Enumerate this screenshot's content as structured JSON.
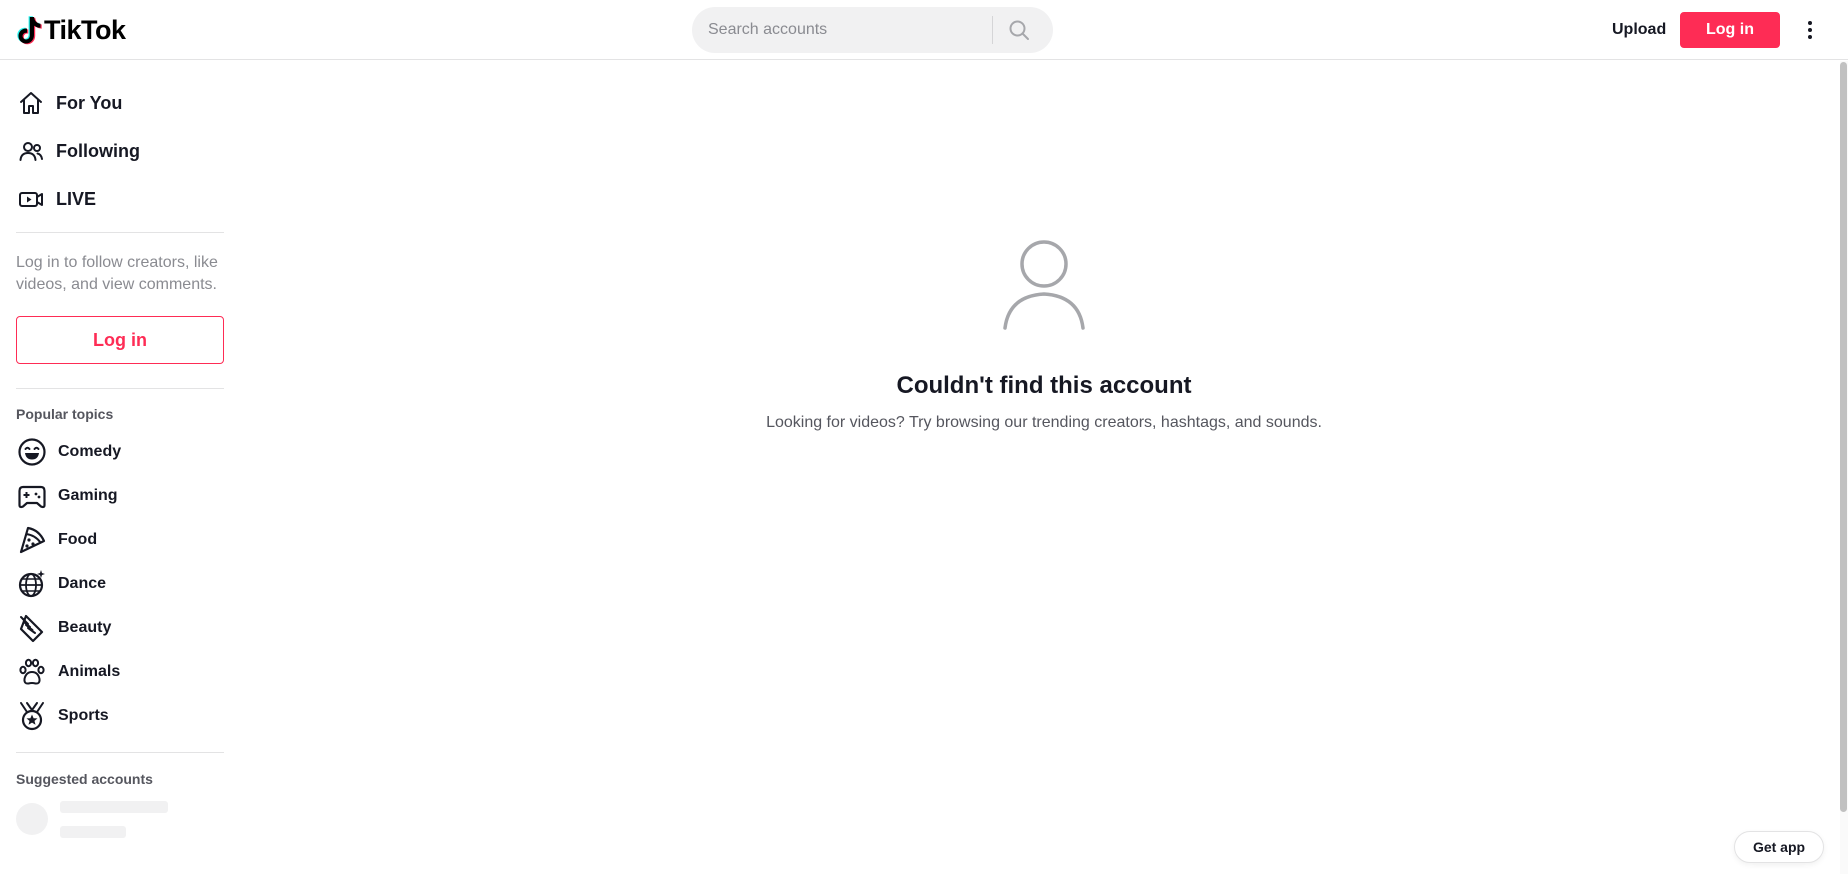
{
  "header": {
    "logo_text": "TikTok",
    "search_placeholder": "Search accounts",
    "upload_label": "Upload",
    "login_label": "Log in"
  },
  "sidebar": {
    "nav": [
      {
        "label": "For You",
        "icon": "home-icon"
      },
      {
        "label": "Following",
        "icon": "following-icon"
      },
      {
        "label": "LIVE",
        "icon": "live-icon"
      }
    ],
    "login_prompt": "Log in to follow creators, like videos, and view comments.",
    "login_label": "Log in",
    "popular_topics_title": "Popular topics",
    "topics": [
      {
        "label": "Comedy",
        "icon": "comedy-icon"
      },
      {
        "label": "Gaming",
        "icon": "gaming-icon"
      },
      {
        "label": "Food",
        "icon": "food-icon"
      },
      {
        "label": "Dance",
        "icon": "dance-icon"
      },
      {
        "label": "Beauty",
        "icon": "beauty-icon"
      },
      {
        "label": "Animals",
        "icon": "animals-icon"
      },
      {
        "label": "Sports",
        "icon": "sports-icon"
      }
    ],
    "suggested_title": "Suggested accounts"
  },
  "main": {
    "title": "Couldn't find this account",
    "subtitle": "Looking for videos? Try browsing our trending creators, hashtags, and sounds."
  },
  "get_app_label": "Get app",
  "colors": {
    "brand": "#fe2c55",
    "text": "#161823",
    "muted": "#8a8b91"
  }
}
